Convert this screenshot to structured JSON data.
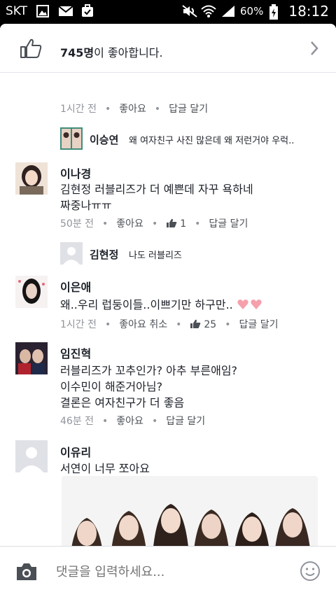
{
  "status_bar": {
    "carrier": "SKT",
    "battery_pct": "60%",
    "time": "18:12"
  },
  "likes": {
    "count": "745명",
    "suffix": "이 좋아합니다."
  },
  "labels": {
    "like": "좋아요",
    "reply": "답글 달기",
    "unlike": "좋아요 취소",
    "dot": "•"
  },
  "top_meta": {
    "time": "1시간 전"
  },
  "comments": [
    {
      "reply_preview": {
        "name": "이승연",
        "text": "왜 여자친구 사진 많은데 왜 저런거야 우럭.."
      }
    },
    {
      "name": "이나경",
      "lines": [
        "김현정 러블리즈가 더 예쁜데 자꾸 욕하네",
        "짜중나ㅠㅠ"
      ],
      "time": "50분 전",
      "like_count": "1",
      "reply_preview": {
        "name": "김현정",
        "text": "나도 러블리즈"
      }
    },
    {
      "name": "이은애",
      "lines": [
        "왜..우리 럽둥이들..이쁘기만 하구만.."
      ],
      "time": "1시간 전",
      "like_count": "25"
    },
    {
      "name": "임진혁",
      "lines": [
        "러블리즈가 꼬추인가? 아추 부른애임?",
        "이수민이 해준거아님?",
        "결론은 여자친구가 더 좋음"
      ],
      "time": "46분 전"
    },
    {
      "name": "이유리",
      "lines": [
        "서연이 너무 쪼아요"
      ]
    }
  ],
  "composer": {
    "placeholder": "댓글을 입력하세요..."
  },
  "colors": {
    "link": "#4b4f56",
    "meta": "#90949c",
    "text": "#1d2129"
  }
}
